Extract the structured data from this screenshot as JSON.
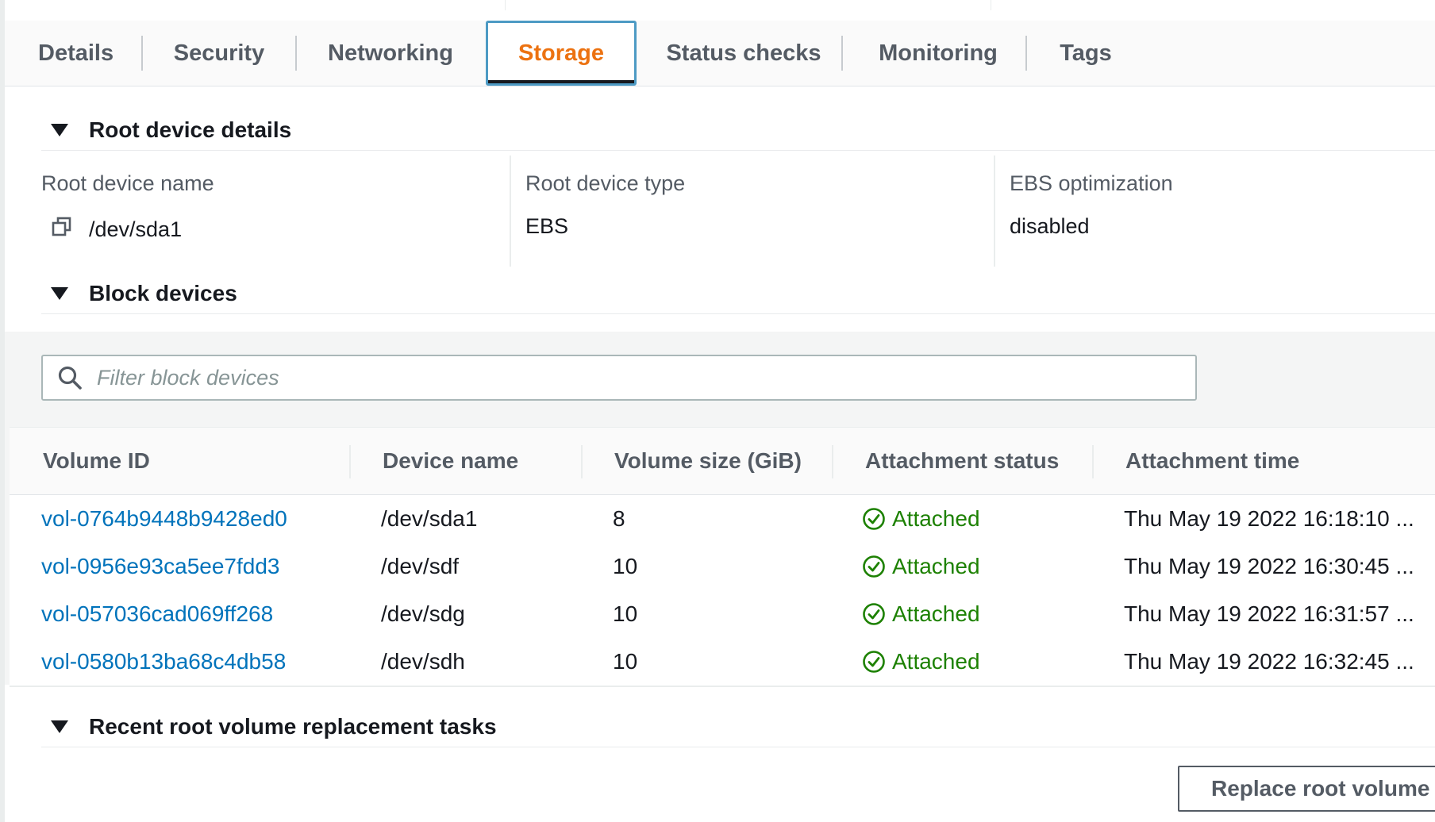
{
  "tabs": [
    {
      "label": "Details"
    },
    {
      "label": "Security"
    },
    {
      "label": "Networking"
    },
    {
      "label": "Storage"
    },
    {
      "label": "Status checks"
    },
    {
      "label": "Monitoring"
    },
    {
      "label": "Tags"
    }
  ],
  "active_tab": "Storage",
  "root_device": {
    "section_title": "Root device details",
    "name_label": "Root device name",
    "name_value": "/dev/sda1",
    "type_label": "Root device type",
    "type_value": "EBS",
    "ebs_label": "EBS optimization",
    "ebs_value": "disabled"
  },
  "block_devices": {
    "section_title": "Block devices",
    "filter_placeholder": "Filter block devices",
    "columns": [
      "Volume ID",
      "Device name",
      "Volume size (GiB)",
      "Attachment status",
      "Attachment time"
    ],
    "rows": [
      {
        "volume_id": "vol-0764b9448b9428ed0",
        "device": "/dev/sda1",
        "size": "8",
        "status": "Attached",
        "time": "Thu May 19 2022 16:18:10 ..."
      },
      {
        "volume_id": "vol-0956e93ca5ee7fdd3",
        "device": "/dev/sdf",
        "size": "10",
        "status": "Attached",
        "time": "Thu May 19 2022 16:30:45 ..."
      },
      {
        "volume_id": "vol-057036cad069ff268",
        "device": "/dev/sdg",
        "size": "10",
        "status": "Attached",
        "time": "Thu May 19 2022 16:31:57 ..."
      },
      {
        "volume_id": "vol-0580b13ba68c4db58",
        "device": "/dev/sdh",
        "size": "10",
        "status": "Attached",
        "time": "Thu May 19 2022 16:32:45 ..."
      }
    ]
  },
  "replacement": {
    "section_title": "Recent root volume replacement tasks",
    "button_label": "Replace root volume"
  },
  "colors": {
    "active_tab_text": "#ec7211",
    "link": "#0073bb",
    "status_ok": "#1d8102"
  },
  "icons": [
    "copy-icon",
    "search-icon",
    "check-circle-icon",
    "caret-down-icon"
  ]
}
